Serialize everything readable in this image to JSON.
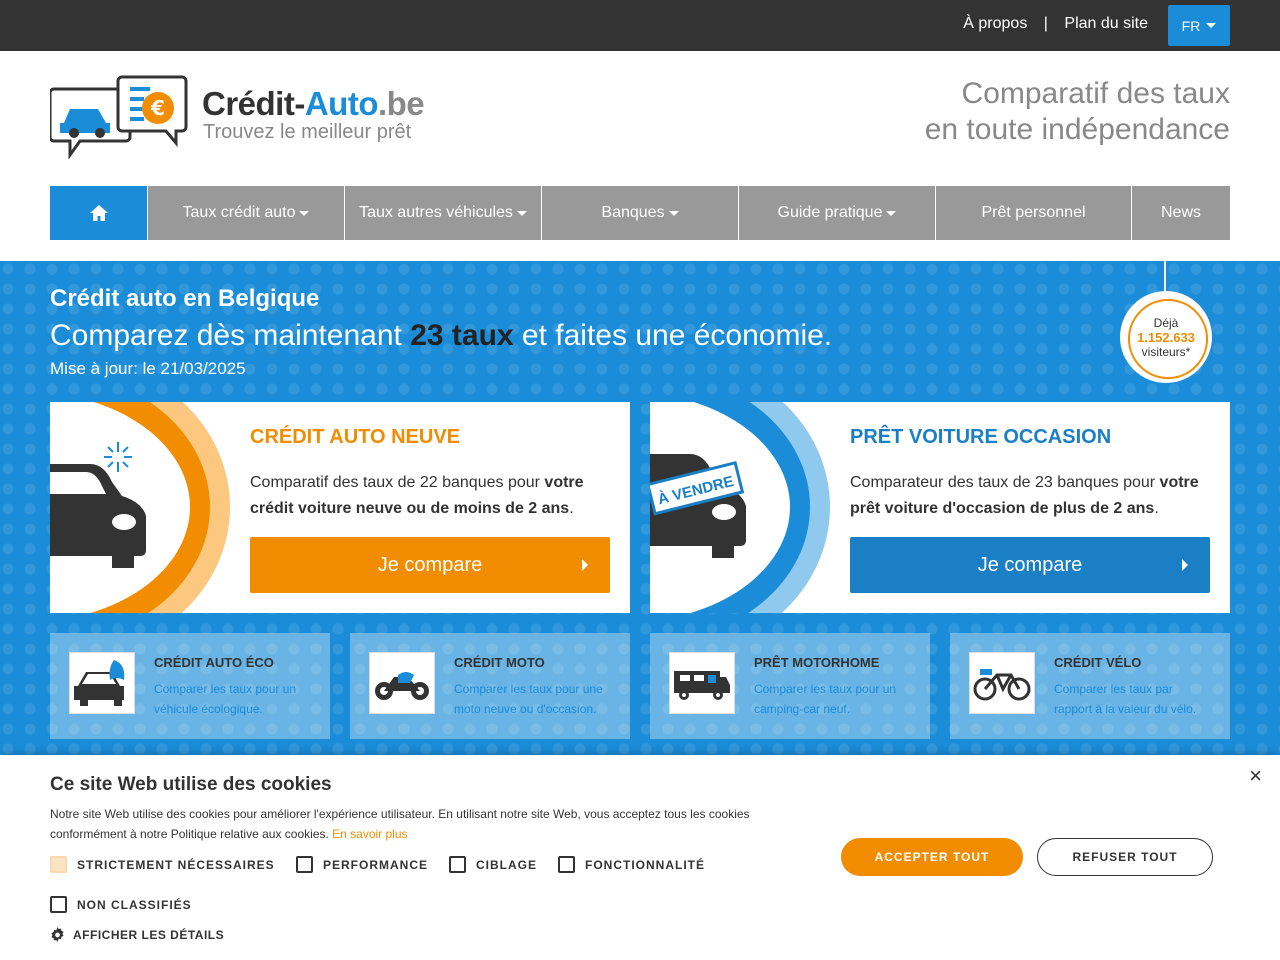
{
  "topbar": {
    "about": "À propos",
    "separator": "|",
    "sitemap": "Plan du site",
    "lang": "FR"
  },
  "header": {
    "logo_part1": "Crédit-",
    "logo_part2": "Auto",
    "logo_tld": ".be",
    "logo_sub": "Trouvez le meilleur prêt",
    "tagline_line1": "Comparatif des taux",
    "tagline_line2": "en toute indépendance"
  },
  "nav": {
    "items": [
      {
        "label": "Taux crédit auto"
      },
      {
        "label": "Taux autres véhicules"
      },
      {
        "label": "Banques"
      },
      {
        "label": "Guide pratique"
      },
      {
        "label": "Prêt personnel"
      },
      {
        "label": "News"
      }
    ]
  },
  "hero": {
    "title": "Crédit auto en Belgique",
    "sub_pre": "Comparez dès maintenant ",
    "sub_bold": "23 taux",
    "sub_post": " et faites une économie.",
    "updated": "Mise à jour: le 21/03/2025",
    "badge_l1": "Déjà",
    "badge_count": "1.152.633",
    "badge_l3": "visiteurs*"
  },
  "cards": [
    {
      "title": "CRÉDIT AUTO NEUVE",
      "text_pre": "Comparatif des taux de 22 banques pour ",
      "text_bold": "votre crédit voiture neuve ou de moins de 2 ans",
      "text_post": ".",
      "cta": "Je compare",
      "color": "#f28c00"
    },
    {
      "title": "PRÊT VOITURE OCCASION",
      "text_pre": "Comparateur des taux de 23 banques pour ",
      "text_bold": "votre prêt voiture d'occasion de plus de 2 ans",
      "text_post": ".",
      "cta": "Je compare",
      "sticker": "À VENDRE",
      "color": "#1a7fc4"
    }
  ],
  "small_cards": [
    {
      "title": "CRÉDIT AUTO ÉCO",
      "text": "Comparer les taux pour un véhicule écologique."
    },
    {
      "title": "CRÉDIT MOTO",
      "text": "Comparer les taux pour une moto neuve ou d'occasion."
    },
    {
      "title": "PRÊT MOTORHOME",
      "text": "Comparer les taux pour un camping-car neuf."
    },
    {
      "title": "CRÉDIT VÉLO",
      "text": "Comparer les taux par rapport à la valeur du vélo."
    }
  ],
  "cookie": {
    "title": "Ce site Web utilise des cookies",
    "text": "Notre site Web utilise des cookies pour améliorer l'expérience utilisateur. En utilisant notre site Web, vous acceptez tous les cookies conformément à notre Politique relative aux cookies. ",
    "more": "En savoir plus",
    "close": "×",
    "opt_strict": "STRICTEMENT NÉCESSAIRES",
    "opt_perf": "PERFORMANCE",
    "opt_target": "CIBLAGE",
    "opt_func": "FONCTIONNALITÉ",
    "opt_unclassified": "NON CLASSIFIÉS",
    "accept": "ACCEPTER TOUT",
    "refuse": "REFUSER TOUT",
    "details": "AFFICHER LES DÉTAILS"
  }
}
